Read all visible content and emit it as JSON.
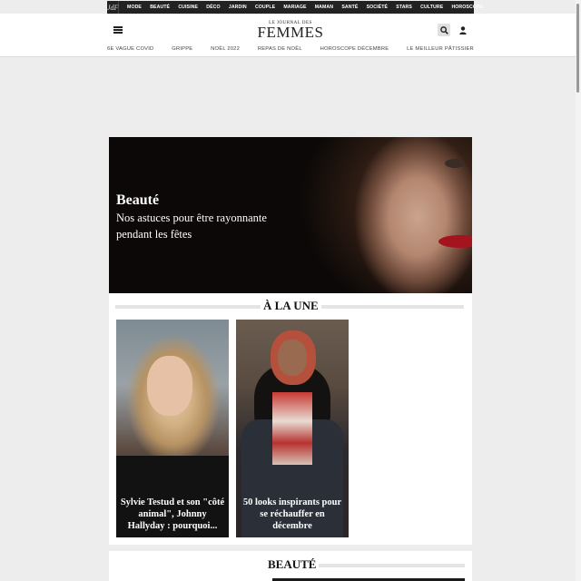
{
  "topnav": {
    "logo": "JdF",
    "items": [
      "MODE",
      "BEAUTÉ",
      "CUISINE",
      "DÉCO",
      "JARDIN",
      "COUPLE",
      "MARIAGE",
      "MAMAN",
      "SANTÉ",
      "SOCIÉTÉ",
      "STARS",
      "CULTURE",
      "HOROSCOPE"
    ]
  },
  "header": {
    "brand_small": "LE JOURNAL DES",
    "brand_big": "FEMMES",
    "icons": {
      "menu": "hamburger-icon",
      "search": "search-icon",
      "account": "user-icon"
    }
  },
  "subnav": {
    "items": [
      "6E VAGUE COVID",
      "GRIPPE",
      "NOËL 2022",
      "REPAS DE NOËL",
      "HOROSCOPE DÉCEMBRE",
      "LE MEILLEUR PÂTISSIER"
    ]
  },
  "hero": {
    "title": "Beauté",
    "subtitle": "Nos astuces pour être rayonnante pendant les fêtes"
  },
  "une": {
    "heading": "À LA UNE",
    "cards": [
      {
        "caption": "Sylvie Testud et son \"côté animal\", Johnny Hallyday : pourquoi..."
      },
      {
        "caption": "50 looks inspirants pour se réchauffer en décembre"
      }
    ]
  },
  "beaute": {
    "heading": "BEAUTÉ"
  },
  "colors": {
    "topnav_bg": "#222222",
    "page_bg": "#ededed",
    "lips": "#a3141f"
  }
}
